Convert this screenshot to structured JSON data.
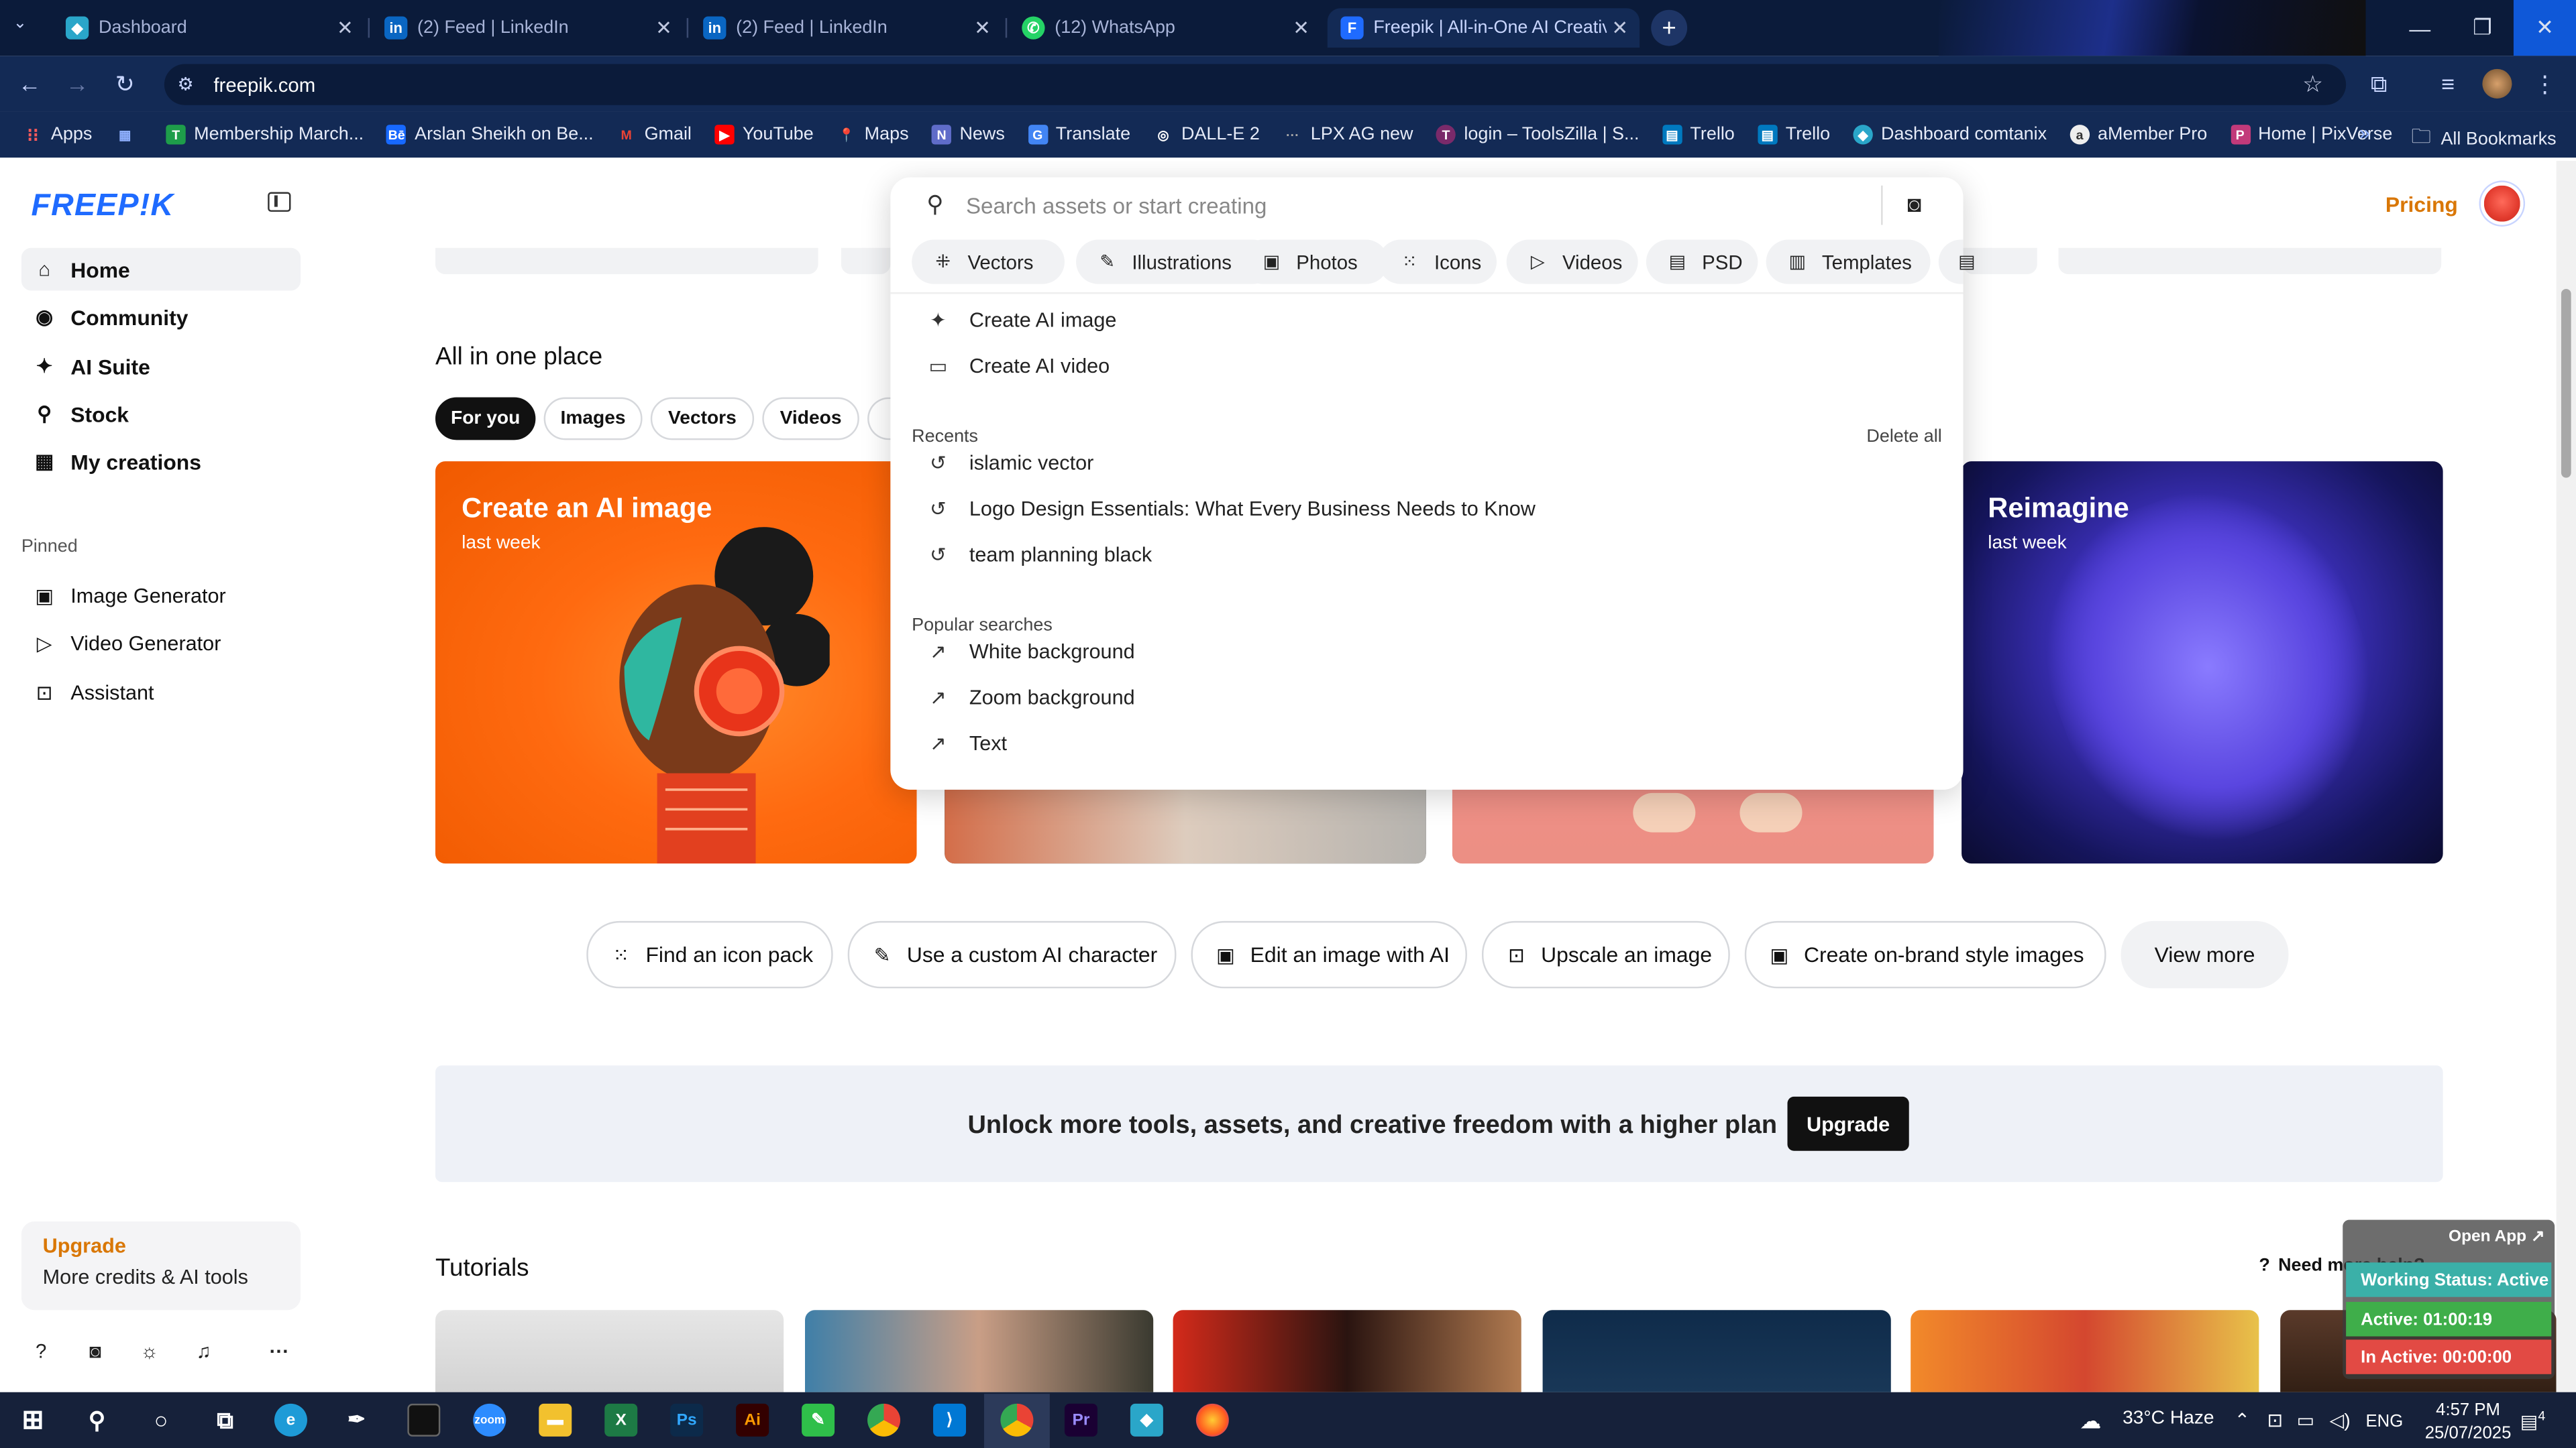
{
  "browser": {
    "tabs": [
      {
        "title": "Dashboard",
        "icon": "dashboard-favicon"
      },
      {
        "title": "(2) Feed | LinkedIn",
        "icon": "linkedin-favicon"
      },
      {
        "title": "(2) Feed | LinkedIn",
        "icon": "linkedin-favicon"
      },
      {
        "title": "(12) WhatsApp",
        "icon": "whatsapp-favicon"
      },
      {
        "title": "Freepik | All-in-One AI Creative",
        "icon": "freepik-favicon"
      }
    ],
    "url": "freepik.com",
    "bookmarks": [
      "Apps",
      "Membership March...",
      "Arslan Sheikh on Be...",
      "Gmail",
      "YouTube",
      "Maps",
      "News",
      "Translate",
      "DALL-E 2",
      "LPX AG new",
      "login – ToolsZilla | S...",
      "Trello",
      "Trello",
      "Dashboard comtanix",
      "aMember Pro",
      "Home | PixVerse"
    ],
    "all_bookmarks": "All Bookmarks"
  },
  "sidebar": {
    "logo": "FREEP!K",
    "nav": [
      "Home",
      "Community",
      "AI Suite",
      "Stock",
      "My creations"
    ],
    "pinned_label": "Pinned",
    "pinned": [
      "Image Generator",
      "Video Generator",
      "Assistant"
    ],
    "upgrade_title": "Upgrade",
    "upgrade_sub": "More credits & AI tools"
  },
  "header": {
    "pricing": "Pricing"
  },
  "search": {
    "placeholder": "Search assets or start creating",
    "chips": [
      "Vectors",
      "Illustrations",
      "Photos",
      "Icons",
      "Videos",
      "PSD",
      "Templates"
    ],
    "create_options": [
      "Create AI image",
      "Create AI video"
    ],
    "recents_label": "Recents",
    "delete_all": "Delete all",
    "recents": [
      "islamic vector",
      "Logo Design Essentials: What Every Business Needs to Know",
      "team planning black"
    ],
    "popular_label": "Popular searches",
    "popular": [
      "White background",
      "Zoom background",
      "Text"
    ]
  },
  "main": {
    "section_title": "All in one place",
    "filters": [
      "For you",
      "Images",
      "Vectors",
      "Videos"
    ],
    "cards": [
      {
        "title": "Create an AI image",
        "sub": "last week"
      },
      {
        "title": "Reimagine",
        "sub": "last week"
      }
    ],
    "actions": [
      "Find an icon pack",
      "Use a custom AI character",
      "Edit an image with AI",
      "Upscale an image",
      "Create on-brand style images",
      "View more"
    ],
    "promo_text": "Unlock more tools, assets, and creative freedom with a higher plan",
    "promo_button": "Upgrade",
    "tutorials_title": "Tutorials",
    "need_help": "Need more help?"
  },
  "tracker": {
    "open_app": "Open App ↗",
    "status": "Working Status: Active",
    "active": "Active: 01:00:19",
    "inactive": "In Active: 00:00:00"
  },
  "taskbar": {
    "weather": "33°C  Haze",
    "lang": "ENG",
    "time": "4:57 PM",
    "date": "25/07/2025",
    "notifications": "4"
  },
  "colors": {
    "brand": "#1f6bff",
    "accent": "#d97706",
    "chrome_dark": "#0b1b3a",
    "chrome": "#132a55"
  }
}
